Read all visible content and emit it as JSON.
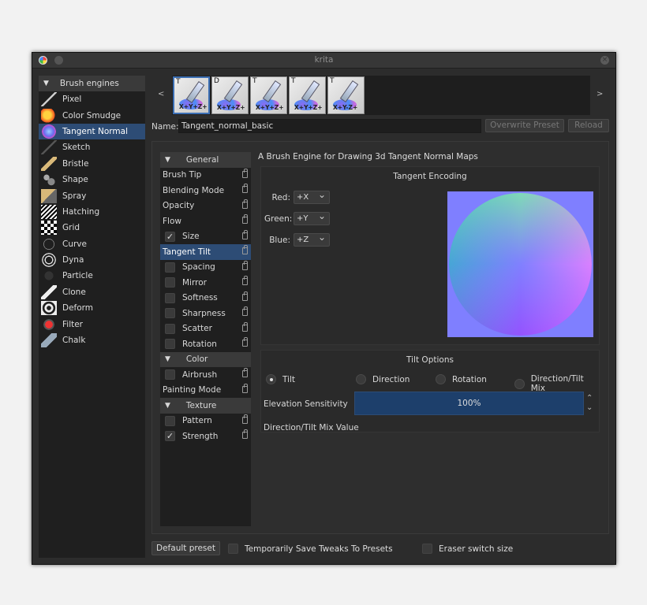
{
  "window": {
    "title": "krita"
  },
  "engines": {
    "header": "Brush engines",
    "items": [
      {
        "label": "Pixel",
        "icon": "pixel-brush-icon"
      },
      {
        "label": "Color Smudge",
        "icon": "color-smudge-icon"
      },
      {
        "label": "Tangent Normal",
        "icon": "tangent-normal-icon",
        "selected": true
      },
      {
        "label": "Sketch",
        "icon": "sketch-icon"
      },
      {
        "label": "Bristle",
        "icon": "bristle-icon"
      },
      {
        "label": "Shape",
        "icon": "shape-icon"
      },
      {
        "label": "Spray",
        "icon": "spray-icon"
      },
      {
        "label": "Hatching",
        "icon": "hatching-icon"
      },
      {
        "label": "Grid",
        "icon": "grid-icon"
      },
      {
        "label": "Curve",
        "icon": "curve-icon"
      },
      {
        "label": "Dyna",
        "icon": "dyna-icon"
      },
      {
        "label": "Particle",
        "icon": "particle-icon"
      },
      {
        "label": "Clone",
        "icon": "clone-icon"
      },
      {
        "label": "Deform",
        "icon": "deform-icon"
      },
      {
        "label": "Filter",
        "icon": "filter-icon"
      },
      {
        "label": "Chalk",
        "icon": "chalk-icon"
      }
    ]
  },
  "presets": {
    "prev": "<",
    "next": ">",
    "items": [
      {
        "letter": "T",
        "code": "X+Y+Z+"
      },
      {
        "letter": "D",
        "code": "X+Y+Z+"
      },
      {
        "letter": "T",
        "code": "X+Y+Z+"
      },
      {
        "letter": "T",
        "code": "X+Y+Z+"
      },
      {
        "letter": "T",
        "code": "X+Y-Z+"
      }
    ]
  },
  "name_row": {
    "label": "Name:",
    "value": "Tangent_normal_basic",
    "overwrite": "Overwrite Preset",
    "reload": "Reload"
  },
  "options": {
    "general_header": "General",
    "brush_tip": "Brush Tip",
    "blending_mode": "Blending Mode",
    "opacity": "Opacity",
    "flow": "Flow",
    "size": "Size",
    "tangent_tilt": "Tangent Tilt",
    "spacing": "Spacing",
    "mirror": "Mirror",
    "softness": "Softness",
    "sharpness": "Sharpness",
    "scatter": "Scatter",
    "rotation": "Rotation",
    "color_header": "Color",
    "airbrush": "Airbrush",
    "painting_mode": "Painting Mode",
    "texture_header": "Texture",
    "pattern": "Pattern",
    "strength": "Strength"
  },
  "description": "A Brush Engine for Drawing 3d Tangent Normal Maps",
  "encoding": {
    "title": "Tangent Encoding",
    "red_label": "Red:",
    "red_value": "+X",
    "green_label": "Green:",
    "green_value": "+Y",
    "blue_label": "Blue:",
    "blue_value": "+Z"
  },
  "tilt": {
    "title": "Tilt Options",
    "opt_tilt": "Tilt",
    "opt_direction": "Direction",
    "opt_rotation": "Rotation",
    "opt_mix": "Direction/Tilt Mix",
    "elevation_label": "Elevation Sensitivity",
    "elevation_value": "100%",
    "mix_label": "Direction/Tilt Mix Value"
  },
  "bottom": {
    "default_preset": "Default preset",
    "temp_save": "Temporarily Save Tweaks To Presets",
    "eraser_switch": "Eraser switch size"
  },
  "colors": {
    "accent": "#2d4c75",
    "background": "#2c2c2c",
    "panel": "#1f1f1f",
    "normal_bg": "#7f7fff"
  }
}
